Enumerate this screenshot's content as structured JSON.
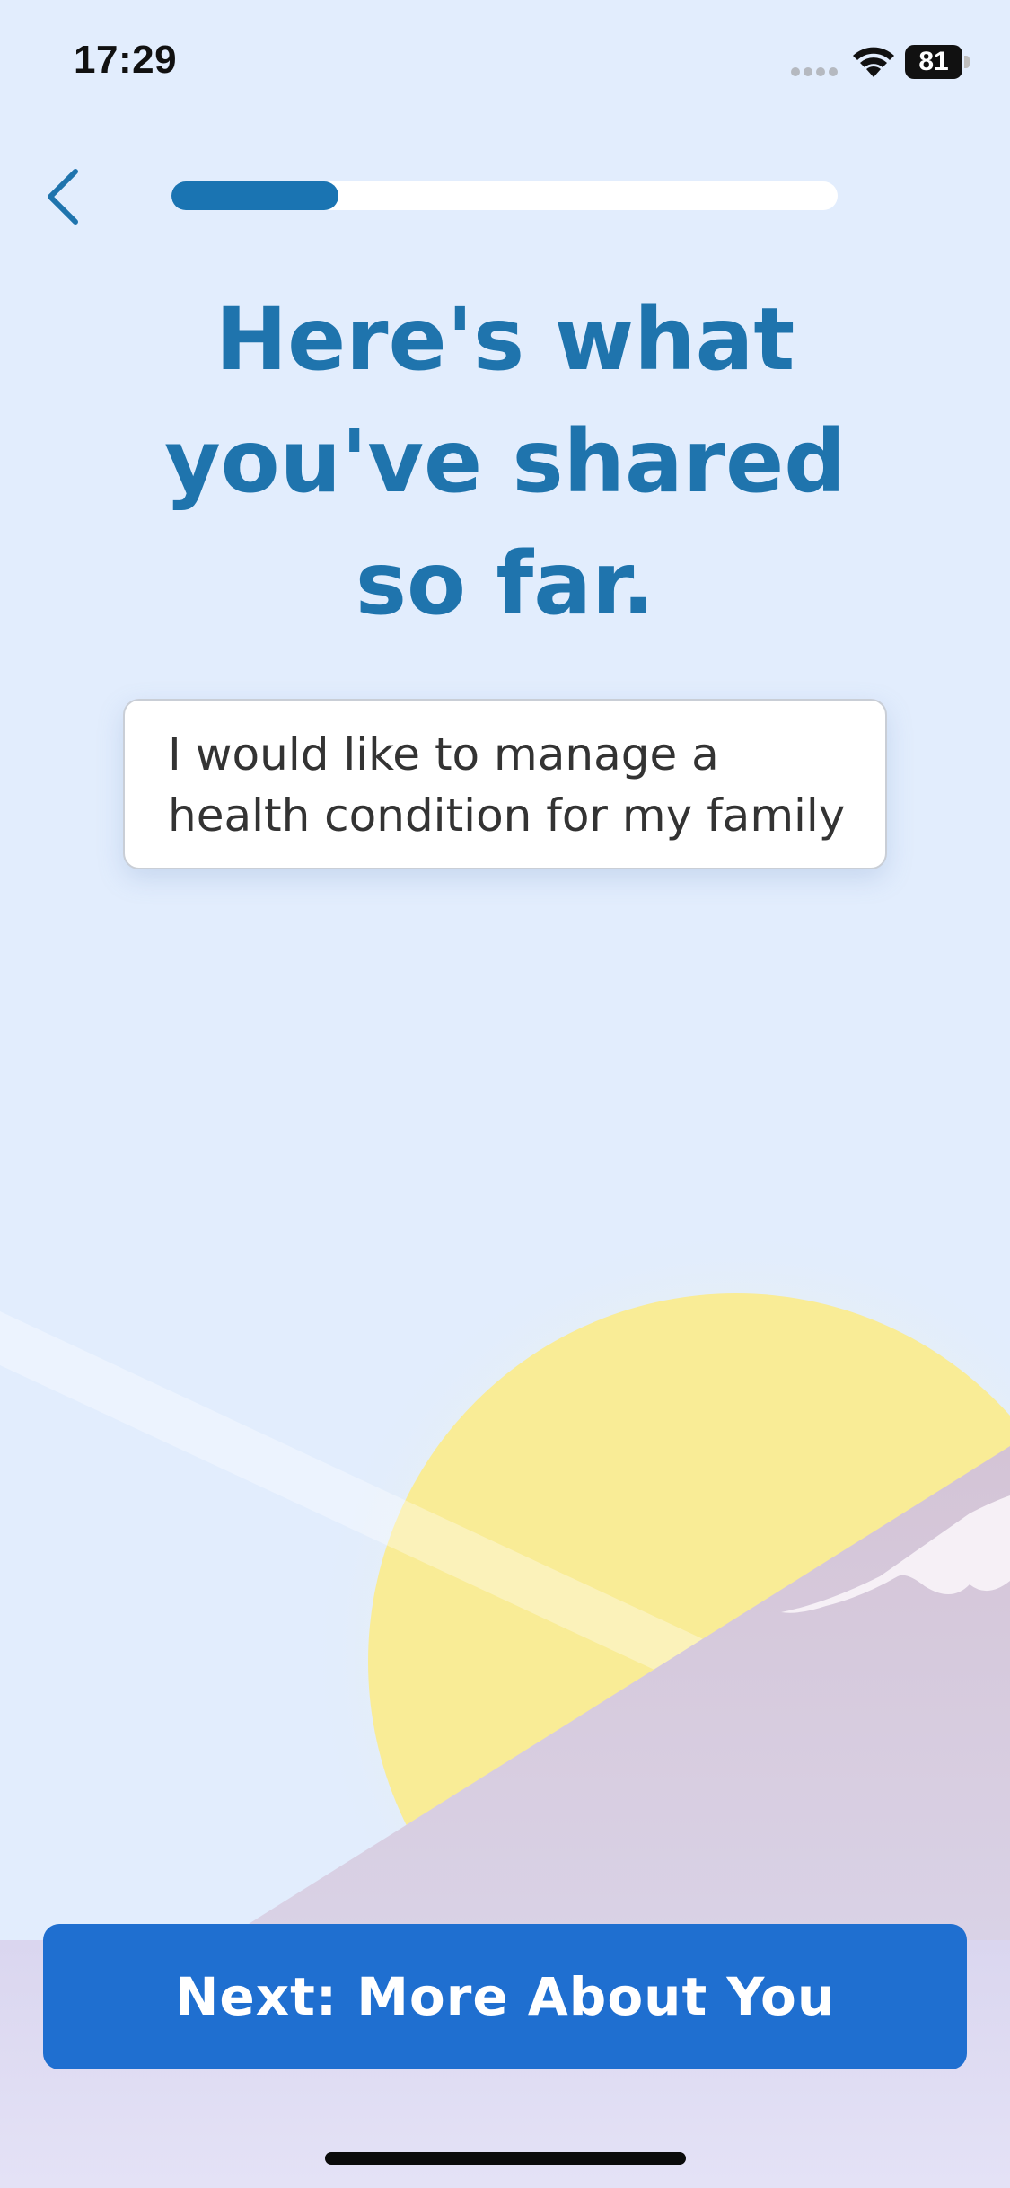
{
  "status_bar": {
    "time": "17:29",
    "battery_level": "81",
    "signal_icon": "cellular-signal-icon",
    "wifi_icon": "wifi-icon",
    "battery_icon": "battery-icon"
  },
  "nav": {
    "back_icon": "chevron-left-icon",
    "progress_fraction": 0.25
  },
  "main": {
    "title": "Here's what\nyou've shared\nso far.",
    "answer": "I would like to manage a health condition for my family"
  },
  "footer": {
    "next_label": "Next: More About You"
  },
  "colors": {
    "background": "#e2edfd",
    "accent": "#1f74ad",
    "button": "#1f6fd0",
    "sun": "#f9ec96",
    "mountain": "#d6c9dd"
  }
}
